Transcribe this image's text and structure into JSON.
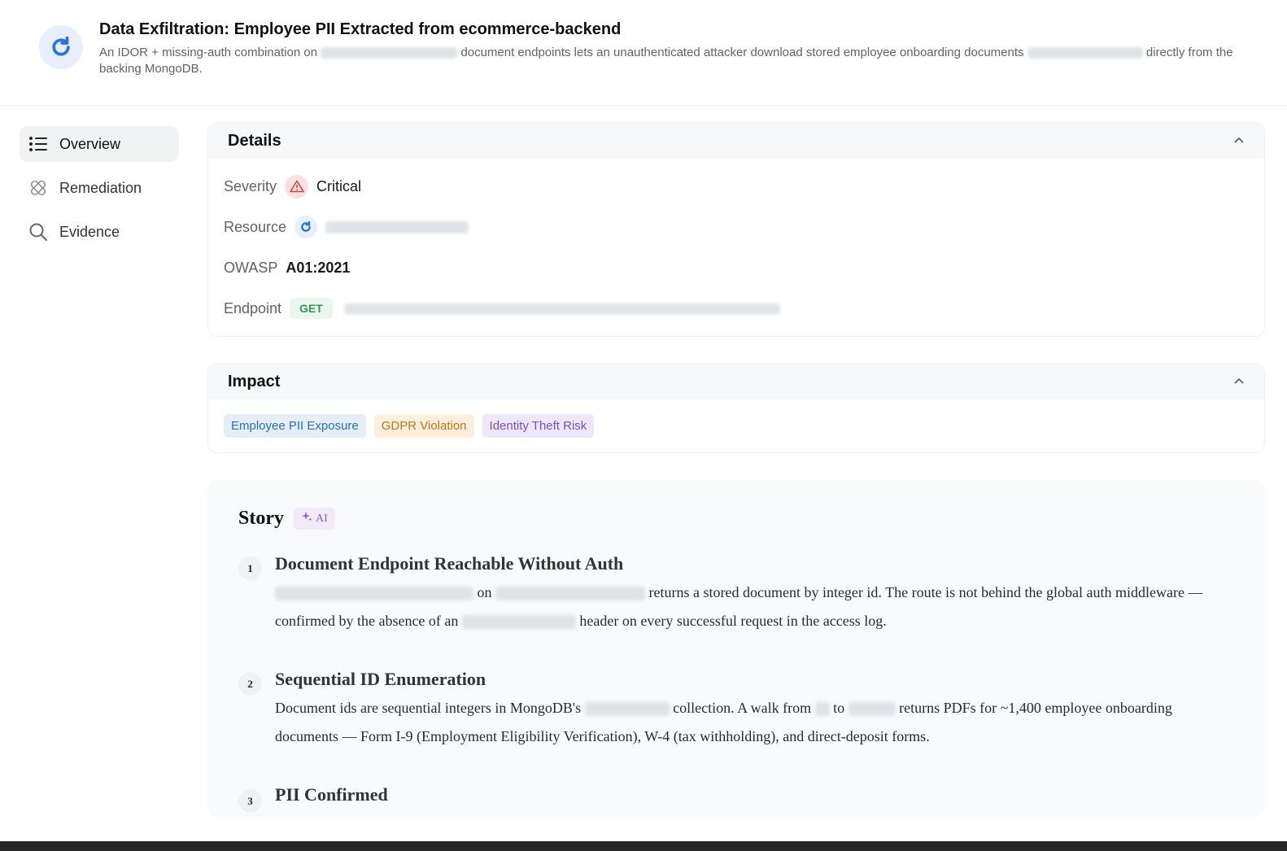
{
  "header": {
    "title": "Data Exfiltration: Employee PII Extracted from ecommerce-backend",
    "desc_part1": "An IDOR + missing-auth combination on",
    "desc_part2": "document endpoints lets an unauthenticated attacker download stored employee onboarding documents",
    "desc_part3": "directly from the backing MongoDB.",
    "icon": "refresh-logo-icon"
  },
  "sidebar": {
    "items": [
      {
        "label": "Overview",
        "icon": "list-icon"
      },
      {
        "label": "Remediation",
        "icon": "bandage-icon"
      },
      {
        "label": "Evidence",
        "icon": "search-icon"
      }
    ]
  },
  "details": {
    "title": "Details",
    "severity_label": "Severity",
    "severity_value": "Critical",
    "resource_label": "Resource",
    "owasp_label": "OWASP",
    "owasp_value": "A01:2021",
    "endpoint_label": "Endpoint",
    "endpoint_method": "GET"
  },
  "impact": {
    "title": "Impact",
    "tags": [
      "Employee PII Exposure",
      "GDPR Violation",
      "Identity Theft Risk"
    ]
  },
  "story": {
    "title": "Story",
    "badge": "AI",
    "steps": [
      {
        "num": "1",
        "title": "Document Endpoint Reachable Without Auth",
        "t1": "on",
        "t2": "returns a stored document by integer id. The route is not behind the global auth middleware — confirmed by the absence of an",
        "t3": "header on every successful request in the access log."
      },
      {
        "num": "2",
        "title": "Sequential ID Enumeration",
        "t1": "Document ids are sequential integers in MongoDB's",
        "t2": "collection. A walk from",
        "t3": "to",
        "t4": "returns PDFs for ~1,400 employee onboarding documents — Form I-9 (Employment Eligibility Verification), W-4 (tax withholding), and direct-deposit forms."
      },
      {
        "num": "3",
        "title": "PII Confirmed"
      }
    ]
  },
  "colors": {
    "accent": "#2f6fde",
    "critical": "#d64545",
    "get": "#2f9a55"
  }
}
